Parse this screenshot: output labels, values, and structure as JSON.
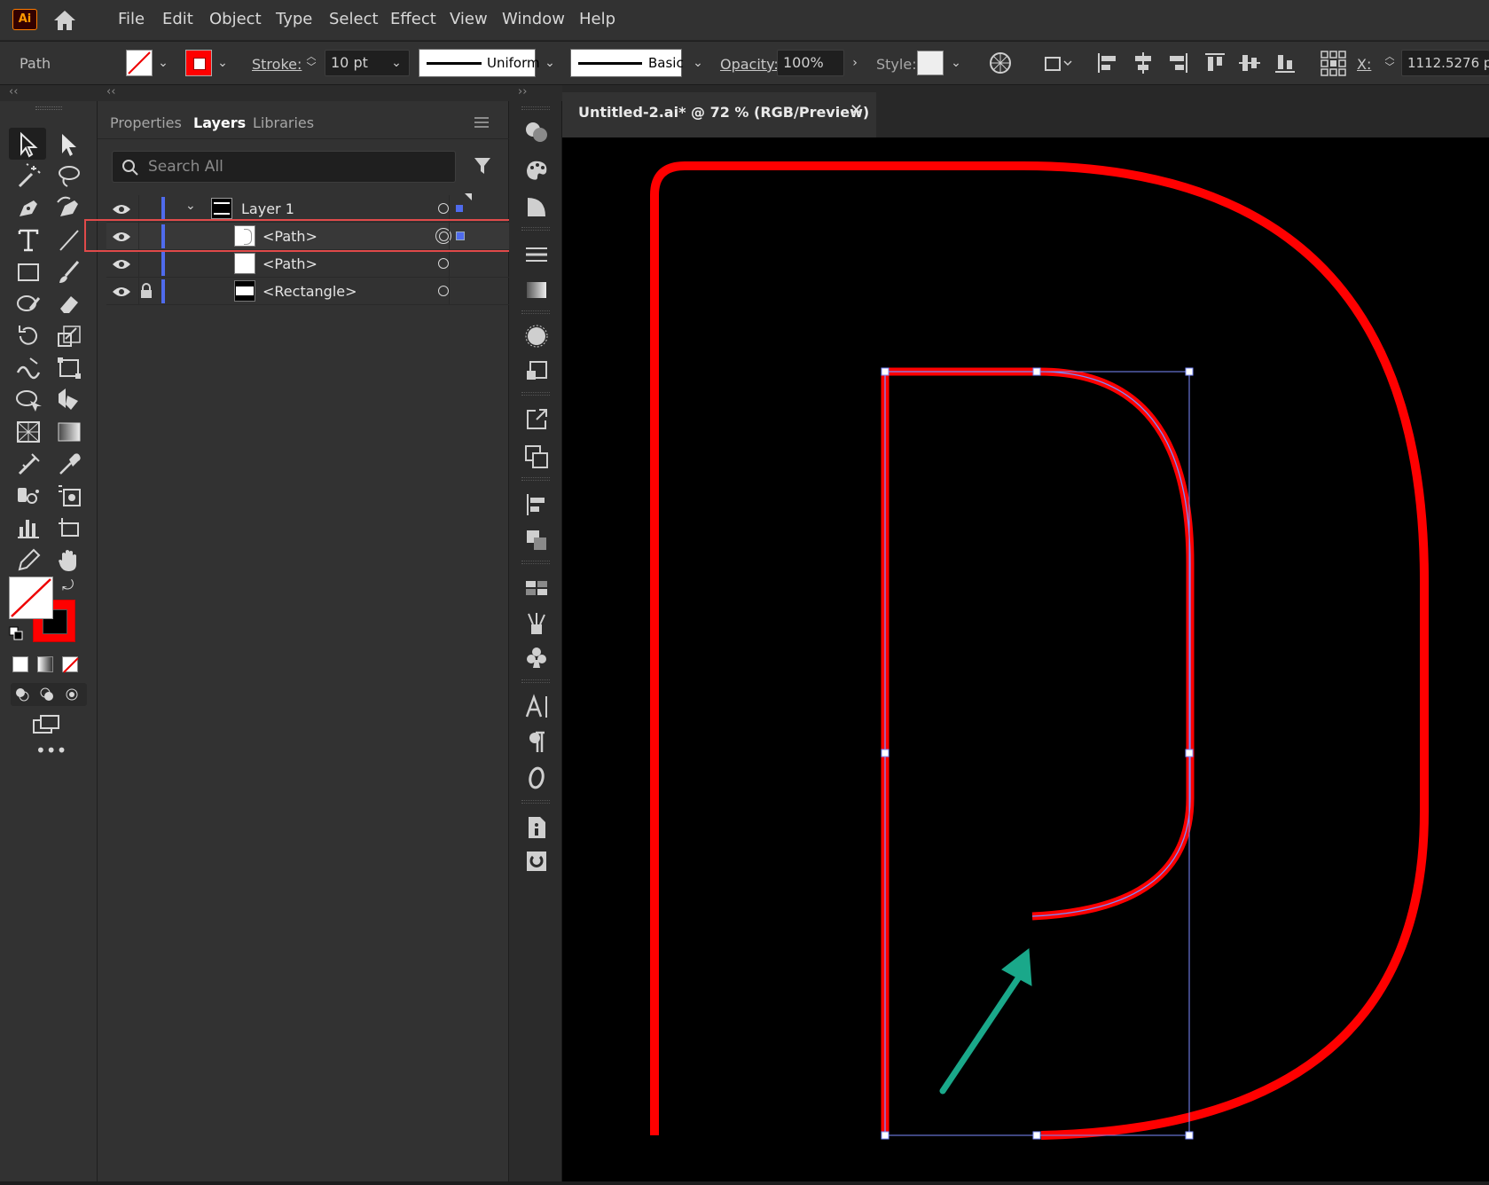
{
  "app": {
    "logo": "Ai"
  },
  "menu": [
    "File",
    "Edit",
    "Object",
    "Type",
    "Select",
    "Effect",
    "View",
    "Window",
    "Help"
  ],
  "control_bar": {
    "selection_type": "Path",
    "stroke_label": "Stroke:",
    "stroke_weight": "10 pt",
    "profile": "Uniform",
    "brush": "Basic",
    "opacity_label": "Opacity:",
    "opacity": "100%",
    "style_label": "Style:",
    "x_label": "X:",
    "x_value": "1112.5276 p",
    "stroke_color": "#ff0000"
  },
  "panel": {
    "tabs": [
      "Properties",
      "Layers",
      "Libraries"
    ],
    "active_tab": "Layers",
    "search_placeholder": "Search All",
    "layers": [
      {
        "name": "Layer 1",
        "level": 0,
        "expanded": true,
        "visible": true,
        "locked": false
      },
      {
        "name": "<Path>",
        "level": 1,
        "visible": true,
        "locked": false,
        "selected": true,
        "highlighted": true
      },
      {
        "name": "<Path>",
        "level": 1,
        "visible": true,
        "locked": false
      },
      {
        "name": "<Rectangle>",
        "level": 1,
        "visible": true,
        "locked": true
      }
    ],
    "layer_color": "#4f6bed",
    "highlight_color": "#e04a4a"
  },
  "document": {
    "tab_title": "Untitled-2.ai* @ 72 % (RGB/Preview)",
    "canvas_color": "#000000",
    "path_color": "#ff0000",
    "selection_color": "#7b8cff",
    "arrow_color": "#1aa88a"
  }
}
